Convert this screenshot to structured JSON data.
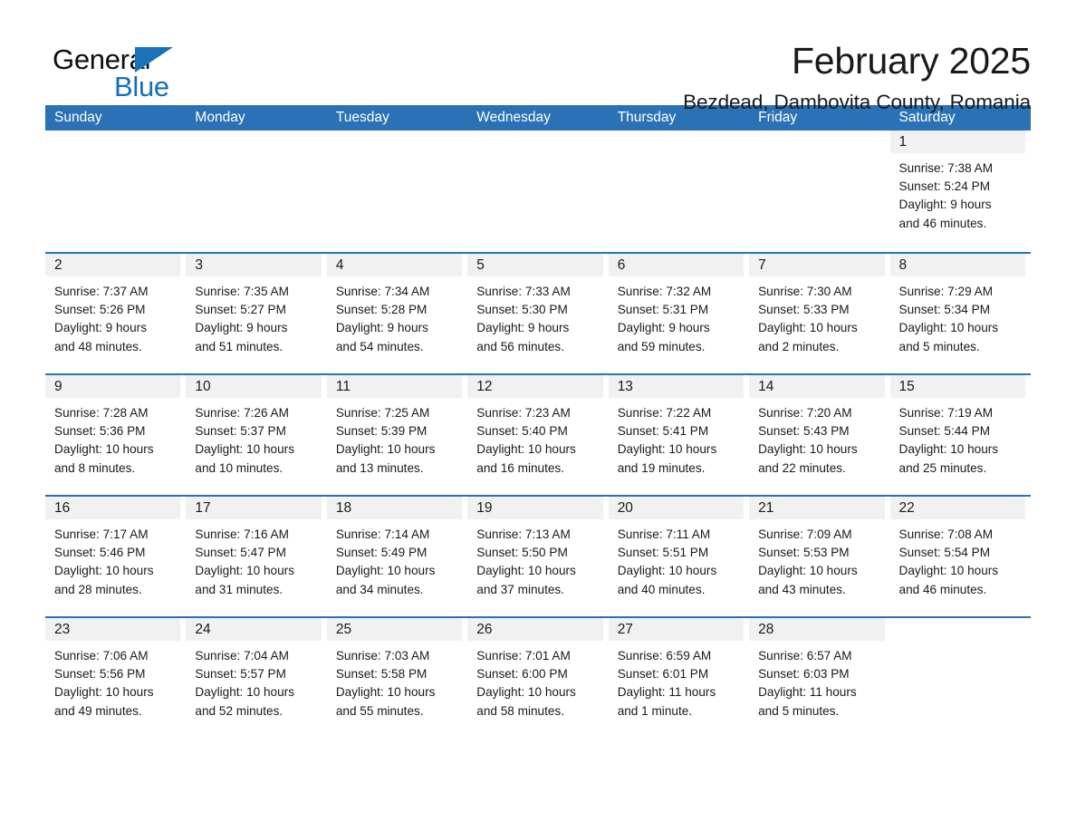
{
  "brand": {
    "name_top": "General",
    "name_bottom": "Blue",
    "triangle_color": "#1b72b8",
    "text_color": "#0f0f0f",
    "blue_color": "#1570b8"
  },
  "header": {
    "title": "February 2025",
    "subtitle": "Bezdead, Dambovita County, Romania"
  },
  "theme": {
    "header_blue": "#2a72b5",
    "daynum_gray": "#f1f1f1",
    "text": "#1a1a1a"
  },
  "calendar": {
    "weekdays": [
      "Sunday",
      "Monday",
      "Tuesday",
      "Wednesday",
      "Thursday",
      "Friday",
      "Saturday"
    ],
    "weeks": [
      [
        {
          "day": "",
          "blank": true
        },
        {
          "day": "",
          "blank": true
        },
        {
          "day": "",
          "blank": true
        },
        {
          "day": "",
          "blank": true
        },
        {
          "day": "",
          "blank": true
        },
        {
          "day": "",
          "blank": true
        },
        {
          "day": "1",
          "sunrise": "Sunrise: 7:38 AM",
          "sunset": "Sunset: 5:24 PM",
          "daylight1": "Daylight: 9 hours",
          "daylight2": "and 46 minutes."
        }
      ],
      [
        {
          "day": "2",
          "sunrise": "Sunrise: 7:37 AM",
          "sunset": "Sunset: 5:26 PM",
          "daylight1": "Daylight: 9 hours",
          "daylight2": "and 48 minutes."
        },
        {
          "day": "3",
          "sunrise": "Sunrise: 7:35 AM",
          "sunset": "Sunset: 5:27 PM",
          "daylight1": "Daylight: 9 hours",
          "daylight2": "and 51 minutes."
        },
        {
          "day": "4",
          "sunrise": "Sunrise: 7:34 AM",
          "sunset": "Sunset: 5:28 PM",
          "daylight1": "Daylight: 9 hours",
          "daylight2": "and 54 minutes."
        },
        {
          "day": "5",
          "sunrise": "Sunrise: 7:33 AM",
          "sunset": "Sunset: 5:30 PM",
          "daylight1": "Daylight: 9 hours",
          "daylight2": "and 56 minutes."
        },
        {
          "day": "6",
          "sunrise": "Sunrise: 7:32 AM",
          "sunset": "Sunset: 5:31 PM",
          "daylight1": "Daylight: 9 hours",
          "daylight2": "and 59 minutes."
        },
        {
          "day": "7",
          "sunrise": "Sunrise: 7:30 AM",
          "sunset": "Sunset: 5:33 PM",
          "daylight1": "Daylight: 10 hours",
          "daylight2": "and 2 minutes."
        },
        {
          "day": "8",
          "sunrise": "Sunrise: 7:29 AM",
          "sunset": "Sunset: 5:34 PM",
          "daylight1": "Daylight: 10 hours",
          "daylight2": "and 5 minutes."
        }
      ],
      [
        {
          "day": "9",
          "sunrise": "Sunrise: 7:28 AM",
          "sunset": "Sunset: 5:36 PM",
          "daylight1": "Daylight: 10 hours",
          "daylight2": "and 8 minutes."
        },
        {
          "day": "10",
          "sunrise": "Sunrise: 7:26 AM",
          "sunset": "Sunset: 5:37 PM",
          "daylight1": "Daylight: 10 hours",
          "daylight2": "and 10 minutes."
        },
        {
          "day": "11",
          "sunrise": "Sunrise: 7:25 AM",
          "sunset": "Sunset: 5:39 PM",
          "daylight1": "Daylight: 10 hours",
          "daylight2": "and 13 minutes."
        },
        {
          "day": "12",
          "sunrise": "Sunrise: 7:23 AM",
          "sunset": "Sunset: 5:40 PM",
          "daylight1": "Daylight: 10 hours",
          "daylight2": "and 16 minutes."
        },
        {
          "day": "13",
          "sunrise": "Sunrise: 7:22 AM",
          "sunset": "Sunset: 5:41 PM",
          "daylight1": "Daylight: 10 hours",
          "daylight2": "and 19 minutes."
        },
        {
          "day": "14",
          "sunrise": "Sunrise: 7:20 AM",
          "sunset": "Sunset: 5:43 PM",
          "daylight1": "Daylight: 10 hours",
          "daylight2": "and 22 minutes."
        },
        {
          "day": "15",
          "sunrise": "Sunrise: 7:19 AM",
          "sunset": "Sunset: 5:44 PM",
          "daylight1": "Daylight: 10 hours",
          "daylight2": "and 25 minutes."
        }
      ],
      [
        {
          "day": "16",
          "sunrise": "Sunrise: 7:17 AM",
          "sunset": "Sunset: 5:46 PM",
          "daylight1": "Daylight: 10 hours",
          "daylight2": "and 28 minutes."
        },
        {
          "day": "17",
          "sunrise": "Sunrise: 7:16 AM",
          "sunset": "Sunset: 5:47 PM",
          "daylight1": "Daylight: 10 hours",
          "daylight2": "and 31 minutes."
        },
        {
          "day": "18",
          "sunrise": "Sunrise: 7:14 AM",
          "sunset": "Sunset: 5:49 PM",
          "daylight1": "Daylight: 10 hours",
          "daylight2": "and 34 minutes."
        },
        {
          "day": "19",
          "sunrise": "Sunrise: 7:13 AM",
          "sunset": "Sunset: 5:50 PM",
          "daylight1": "Daylight: 10 hours",
          "daylight2": "and 37 minutes."
        },
        {
          "day": "20",
          "sunrise": "Sunrise: 7:11 AM",
          "sunset": "Sunset: 5:51 PM",
          "daylight1": "Daylight: 10 hours",
          "daylight2": "and 40 minutes."
        },
        {
          "day": "21",
          "sunrise": "Sunrise: 7:09 AM",
          "sunset": "Sunset: 5:53 PM",
          "daylight1": "Daylight: 10 hours",
          "daylight2": "and 43 minutes."
        },
        {
          "day": "22",
          "sunrise": "Sunrise: 7:08 AM",
          "sunset": "Sunset: 5:54 PM",
          "daylight1": "Daylight: 10 hours",
          "daylight2": "and 46 minutes."
        }
      ],
      [
        {
          "day": "23",
          "sunrise": "Sunrise: 7:06 AM",
          "sunset": "Sunset: 5:56 PM",
          "daylight1": "Daylight: 10 hours",
          "daylight2": "and 49 minutes."
        },
        {
          "day": "24",
          "sunrise": "Sunrise: 7:04 AM",
          "sunset": "Sunset: 5:57 PM",
          "daylight1": "Daylight: 10 hours",
          "daylight2": "and 52 minutes."
        },
        {
          "day": "25",
          "sunrise": "Sunrise: 7:03 AM",
          "sunset": "Sunset: 5:58 PM",
          "daylight1": "Daylight: 10 hours",
          "daylight2": "and 55 minutes."
        },
        {
          "day": "26",
          "sunrise": "Sunrise: 7:01 AM",
          "sunset": "Sunset: 6:00 PM",
          "daylight1": "Daylight: 10 hours",
          "daylight2": "and 58 minutes."
        },
        {
          "day": "27",
          "sunrise": "Sunrise: 6:59 AM",
          "sunset": "Sunset: 6:01 PM",
          "daylight1": "Daylight: 11 hours",
          "daylight2": "and 1 minute."
        },
        {
          "day": "28",
          "sunrise": "Sunrise: 6:57 AM",
          "sunset": "Sunset: 6:03 PM",
          "daylight1": "Daylight: 11 hours",
          "daylight2": "and 5 minutes."
        },
        {
          "day": "",
          "blank": true
        }
      ]
    ]
  }
}
